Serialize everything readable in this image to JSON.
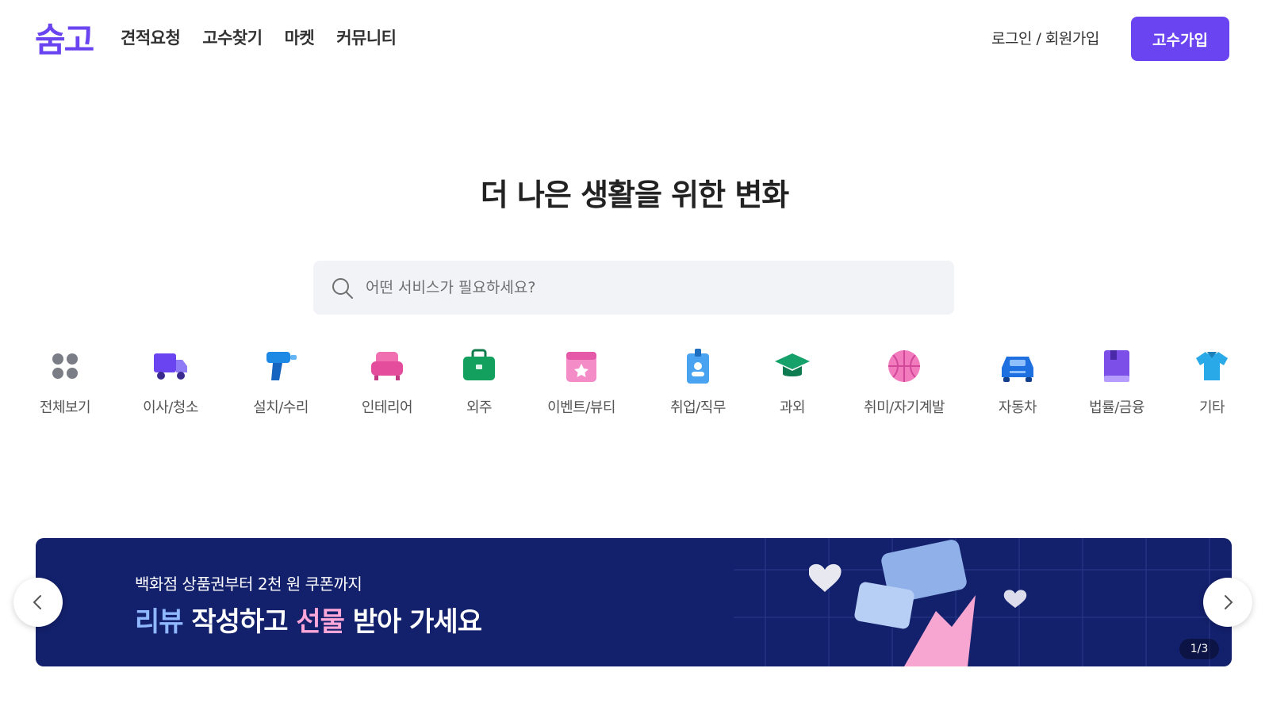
{
  "header": {
    "logo": "숨고",
    "nav": [
      "견적요청",
      "고수찾기",
      "마켓",
      "커뮤니티"
    ],
    "login_label": "로그인 / 회원가입",
    "join_label": "고수가입"
  },
  "hero": {
    "title": "더 나은 생활을 위한 변화",
    "search_placeholder": "어떤 서비스가 필요하세요?"
  },
  "categories": [
    {
      "label": "전체보기",
      "icon": "grid-dots-icon"
    },
    {
      "label": "이사/청소",
      "icon": "truck-icon"
    },
    {
      "label": "설치/수리",
      "icon": "drill-icon"
    },
    {
      "label": "인테리어",
      "icon": "sofa-icon"
    },
    {
      "label": "외주",
      "icon": "briefcase-icon"
    },
    {
      "label": "이벤트/뷰티",
      "icon": "calendar-star-icon"
    },
    {
      "label": "취업/직무",
      "icon": "id-badge-icon"
    },
    {
      "label": "과외",
      "icon": "graduation-cap-icon"
    },
    {
      "label": "취미/자기계발",
      "icon": "basketball-icon"
    },
    {
      "label": "자동차",
      "icon": "car-icon"
    },
    {
      "label": "법률/금융",
      "icon": "book-icon"
    },
    {
      "label": "기타",
      "icon": "shirt-icon"
    }
  ],
  "banner": {
    "subtitle": "백화점 상품권부터 2천 원 쿠폰까지",
    "title_part1": "리뷰",
    "title_part2": " 작성하고 ",
    "title_part3": "선물",
    "title_part4": " 받아 가세요",
    "page_indicator": "1/3"
  },
  "colors": {
    "brand": "#6a44f0",
    "banner_bg": "#13206b"
  }
}
